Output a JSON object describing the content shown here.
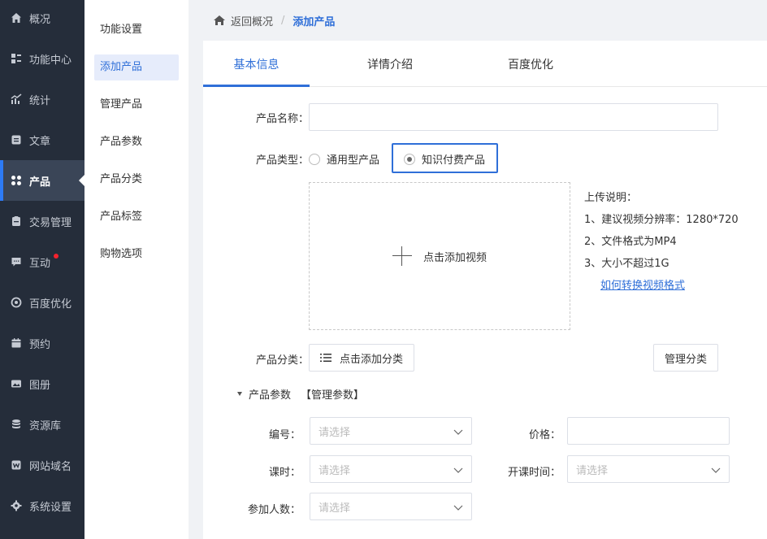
{
  "sidebar": {
    "items": [
      {
        "label": "概况",
        "icon": "home-icon"
      },
      {
        "label": "功能中心",
        "icon": "function-center-icon"
      },
      {
        "label": "统计",
        "icon": "statistics-icon"
      },
      {
        "label": "文章",
        "icon": "article-icon"
      },
      {
        "label": "产品",
        "icon": "product-icon",
        "active": true
      },
      {
        "label": "交易管理",
        "icon": "transaction-icon"
      },
      {
        "label": "互动",
        "icon": "chat-icon",
        "badge": "red-dot"
      },
      {
        "label": "百度优化",
        "icon": "seo-icon"
      },
      {
        "label": "预约",
        "icon": "calendar-icon"
      },
      {
        "label": "图册",
        "icon": "album-icon"
      },
      {
        "label": "资源库",
        "icon": "database-icon"
      },
      {
        "label": "网站域名",
        "icon": "domain-icon"
      },
      {
        "label": "系统设置",
        "icon": "gear-icon"
      }
    ]
  },
  "submenu": {
    "items": [
      {
        "label": "功能设置"
      },
      {
        "label": "添加产品",
        "active": true
      },
      {
        "label": "管理产品"
      },
      {
        "label": "产品参数"
      },
      {
        "label": "产品分类"
      },
      {
        "label": "产品标签"
      },
      {
        "label": "购物选项"
      }
    ]
  },
  "breadcrumb": {
    "back": "返回概况",
    "separator": "/",
    "current": "添加产品"
  },
  "tabs": [
    {
      "label": "基本信息",
      "active": true
    },
    {
      "label": "详情介绍"
    },
    {
      "label": "百度优化"
    }
  ],
  "form": {
    "name_label": "产品名称：",
    "name_value": "",
    "type_label": "产品类型：",
    "type_options": [
      "通用型产品",
      "知识付费产品"
    ],
    "type_selected": "知识付费产品",
    "upload_label": "点击添加视频",
    "notes": {
      "title": "上传说明：",
      "lines": [
        "1、建议视频分辨率：1280*720",
        "2、文件格式为MP4",
        "3、大小不超过1G"
      ],
      "link": "如何转换视频格式"
    },
    "category_label": "产品分类：",
    "category_button": "点击添加分类",
    "manage_category_button": "管理分类",
    "params_title": "产品参数",
    "params_manage": "【管理参数】",
    "code_label": "编号：",
    "code_placeholder": "请选择",
    "price_label": "价格：",
    "price_value": "",
    "hours_label": "课时：",
    "hours_placeholder": "请选择",
    "start_label": "开课时间：",
    "start_placeholder": "请选择",
    "people_label": "参加人数：",
    "people_placeholder": "请选择"
  },
  "colors": {
    "sidebar_bg": "#252d3a",
    "accent": "#2f6fd8",
    "badge": "#f5222d"
  }
}
